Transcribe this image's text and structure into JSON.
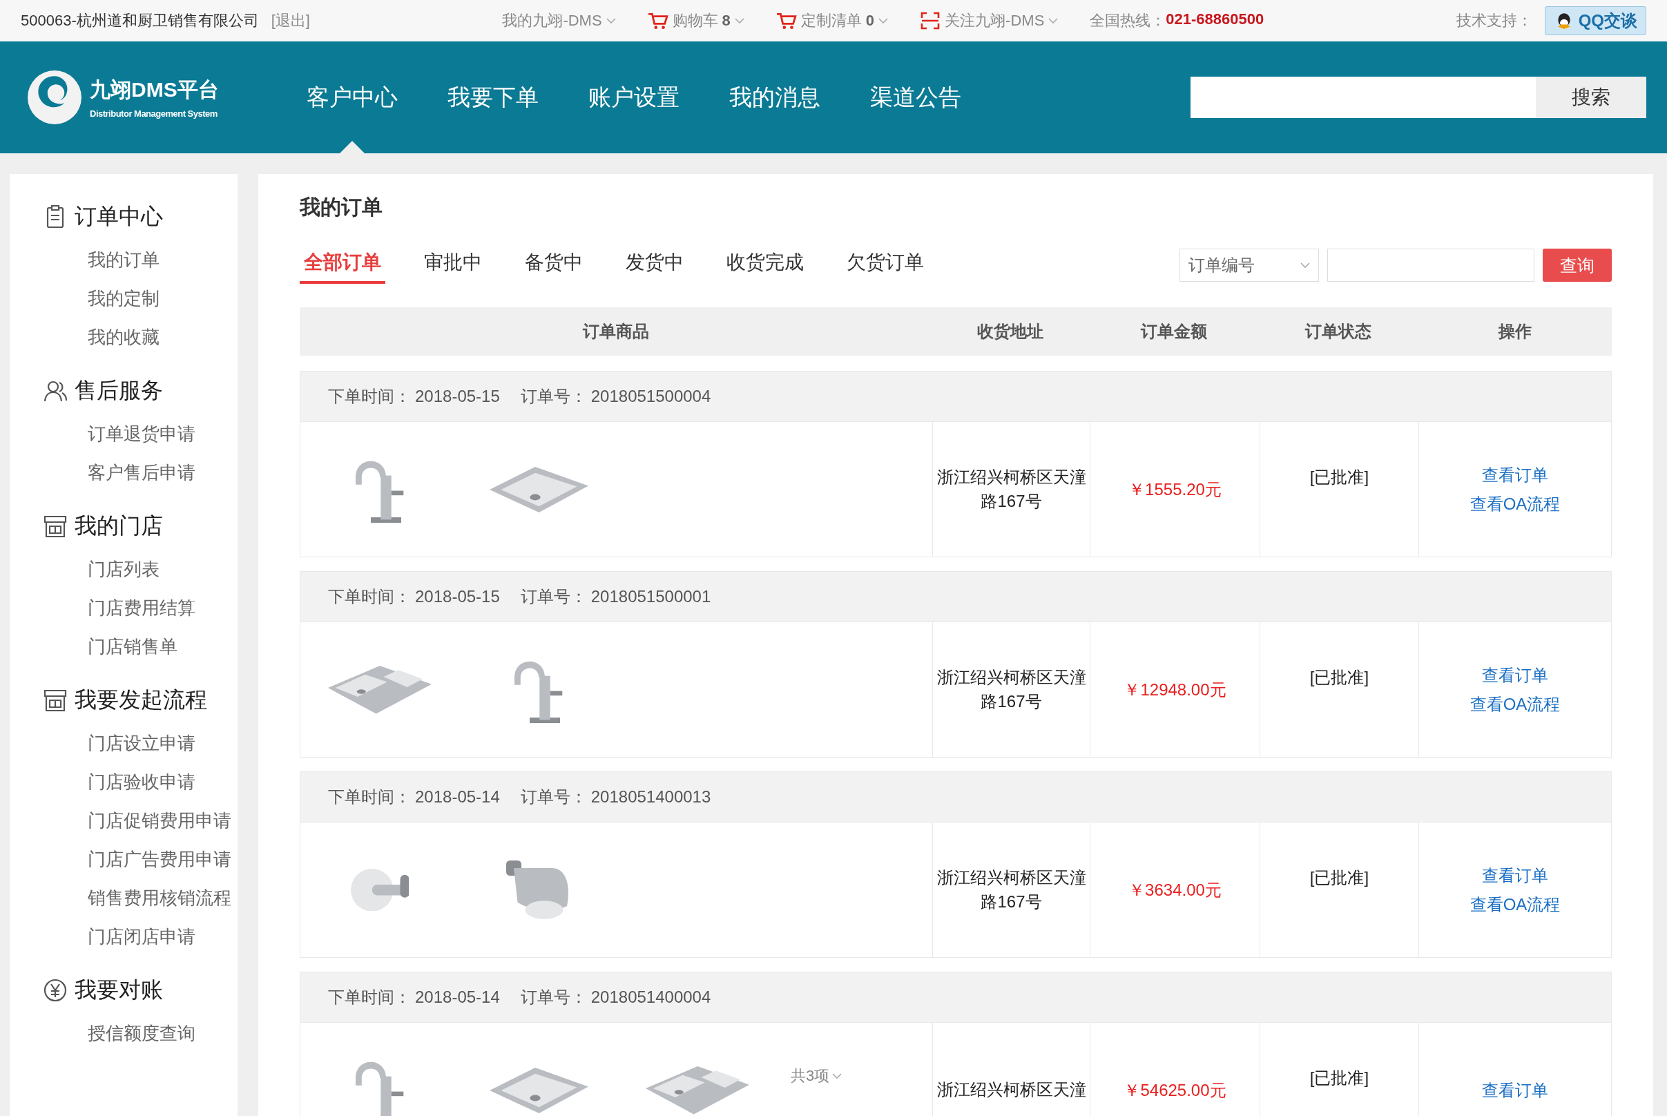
{
  "top_bar": {
    "company": "500063-杭州道和厨卫销售有限公司",
    "logout": "[退出]",
    "menus": [
      {
        "kind": "dropdown",
        "label": "我的九翊-DMS"
      },
      {
        "kind": "cart",
        "label": "购物车",
        "count": "8"
      },
      {
        "kind": "cart",
        "label": "定制清单",
        "count": "0"
      },
      {
        "kind": "follow",
        "label": "关注九翊-DMS"
      }
    ],
    "hotline_label": "全国热线：",
    "hotline": "021-68860500",
    "support_label": "技术支持：",
    "qq_button": "QQ交谈"
  },
  "header": {
    "logo_title": "九翊DMS平台",
    "logo_subtitle": "Distributor Management System",
    "nav": [
      {
        "label": "客户中心",
        "selected": true
      },
      {
        "label": "我要下单",
        "selected": false
      },
      {
        "label": "账户设置",
        "selected": false
      },
      {
        "label": "我的消息",
        "selected": false
      },
      {
        "label": "渠道公告",
        "selected": false
      }
    ],
    "search_button": "搜索"
  },
  "sidebar": [
    {
      "kind": "clipboard",
      "title": "订单中心",
      "items": [
        "我的订单",
        "我的定制",
        "我的收藏"
      ]
    },
    {
      "kind": "person",
      "title": "售后服务",
      "items": [
        "订单退货申请",
        "客户售后申请"
      ]
    },
    {
      "kind": "store",
      "title": "我的门店",
      "items": [
        "门店列表",
        "门店费用结算",
        "门店销售单"
      ]
    },
    {
      "kind": "store",
      "title": "我要发起流程",
      "items": [
        "门店设立申请",
        "门店验收申请",
        "门店促销费用申请",
        "门店广告费用申请",
        "销售费用核销流程",
        "门店闭店申请"
      ]
    },
    {
      "kind": "yen",
      "title": "我要对账",
      "items": [
        "授信额度查询"
      ]
    }
  ],
  "main": {
    "title": "我的订单",
    "tabs": [
      {
        "label": "全部订单",
        "selected": true
      },
      {
        "label": "审批中",
        "selected": false
      },
      {
        "label": "备货中",
        "selected": false
      },
      {
        "label": "发货中",
        "selected": false
      },
      {
        "label": "收货完成",
        "selected": false
      },
      {
        "label": "欠货订单",
        "selected": false
      }
    ],
    "filter_select": "订单编号",
    "query_button": "查询",
    "columns": [
      "订单商品",
      "收货地址",
      "订单金额",
      "订单状态",
      "操作"
    ],
    "orders": [
      {
        "time_label": "下单时间：",
        "time": "2018-05-15",
        "no_label": "订单号：",
        "no": "2018051500004",
        "products": [
          {
            "kind": "faucet"
          },
          {
            "kind": "sink"
          }
        ],
        "address": "浙江绍兴柯桥区天潼路167号",
        "amount": "￥1555.20元",
        "status": "[已批准]",
        "actions": [
          "查看订单",
          "查看OA流程"
        ]
      },
      {
        "time_label": "下单时间：",
        "time": "2018-05-15",
        "no_label": "订单号：",
        "no": "2018051500001",
        "products": [
          {
            "kind": "double-sink"
          },
          {
            "kind": "faucet"
          }
        ],
        "address": "浙江绍兴柯桥区天潼路167号",
        "amount": "￥12948.00元",
        "status": "[已批准]",
        "actions": [
          "查看订单",
          "查看OA流程"
        ]
      },
      {
        "time_label": "下单时间：",
        "time": "2018-05-14",
        "no_label": "订单号：",
        "no": "2018051400013",
        "products": [
          {
            "kind": "hook"
          },
          {
            "kind": "paper-holder"
          }
        ],
        "address": "浙江绍兴柯桥区天潼路167号",
        "amount": "￥3634.00元",
        "status": "[已批准]",
        "actions": [
          "查看订单",
          "查看OA流程"
        ]
      },
      {
        "time_label": "下单时间：",
        "time": "2018-05-14",
        "no_label": "订单号：",
        "no": "2018051400004",
        "products": [
          {
            "kind": "faucet"
          },
          {
            "kind": "sink"
          },
          {
            "kind": "double-sink"
          }
        ],
        "more": "共3项",
        "address": "浙江绍兴柯桥区天潼",
        "amount": "￥54625.00元",
        "status": "[已批准]",
        "actions": [
          "查看订单"
        ]
      }
    ]
  }
}
